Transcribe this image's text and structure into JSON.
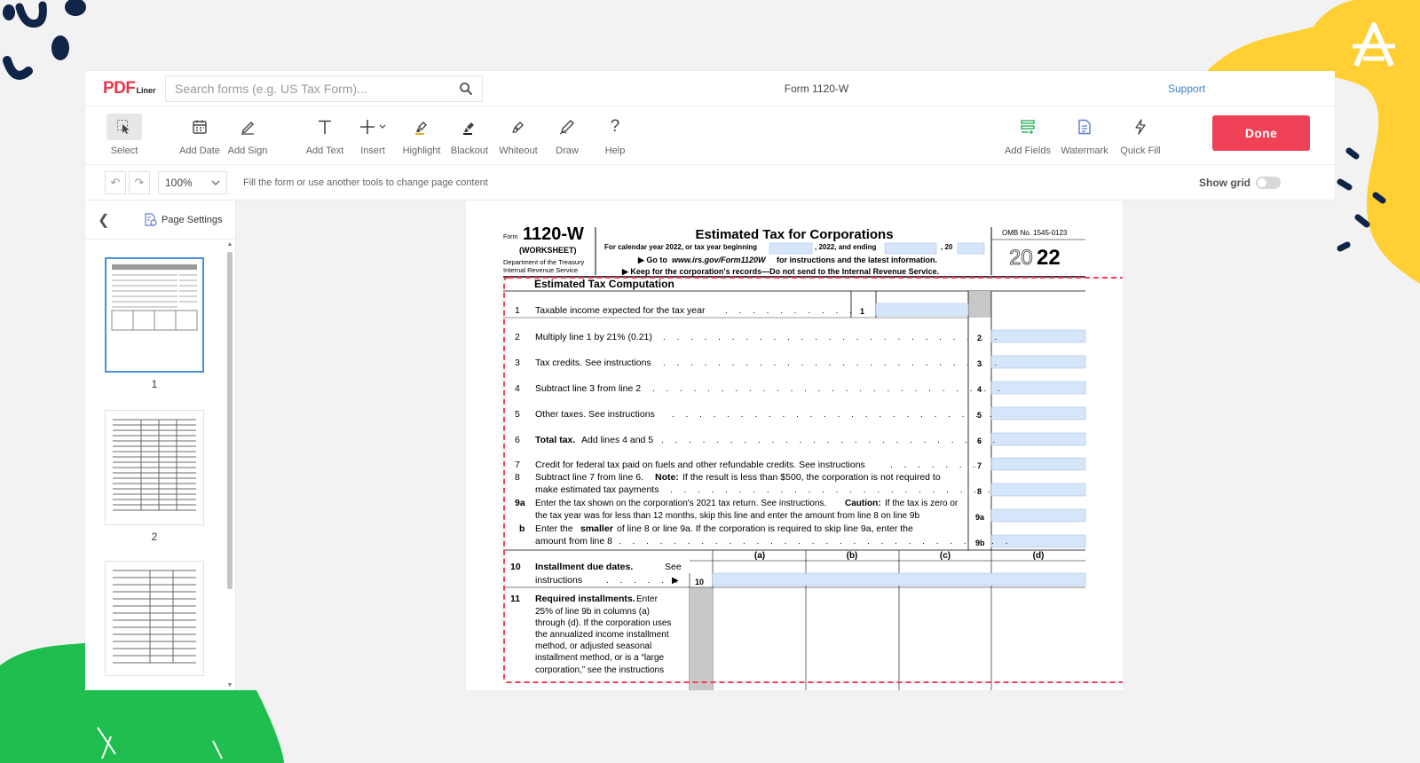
{
  "app": {
    "brand_pdf": "PDF",
    "brand_liner": "Liner",
    "doc_title": "Form 1120-W",
    "support_label": "Support"
  },
  "search": {
    "placeholder": "Search forms (e.g. US Tax Form)...",
    "icon": "search-icon"
  },
  "toolbar": {
    "tools": [
      {
        "label": "Select",
        "icon": "cursor-icon"
      },
      {
        "label": "Add Date",
        "icon": "calendar-icon"
      },
      {
        "label": "Add Sign",
        "icon": "signature-icon"
      },
      {
        "label": "Add Text",
        "icon": "text-icon"
      },
      {
        "label": "Insert",
        "icon": "plus-icon"
      },
      {
        "label": "Highlight",
        "icon": "highlighter-icon"
      },
      {
        "label": "Blackout",
        "icon": "blackout-icon"
      },
      {
        "label": "Whiteout",
        "icon": "whiteout-icon"
      },
      {
        "label": "Draw",
        "icon": "pen-icon"
      },
      {
        "label": "Help",
        "icon": "help-icon"
      },
      {
        "label": "Add Fields",
        "icon": "fields-icon"
      },
      {
        "label": "Watermark",
        "icon": "watermark-icon"
      },
      {
        "label": "Quick Fill",
        "icon": "bolt-icon"
      }
    ],
    "done_label": "Done",
    "accent": "#ef4257"
  },
  "subbar": {
    "zoom": "100%",
    "hint": "Fill the form or use another tools to change page content",
    "show_grid_label": "Show grid"
  },
  "sidebar": {
    "page_settings_label": "Page Settings",
    "thumbs": [
      {
        "num": "1"
      },
      {
        "num": "2"
      }
    ]
  },
  "form": {
    "form_word": "Form",
    "form_number": "1120-W",
    "worksheet": "(WORKSHEET)",
    "dept": "Department of the Treasury",
    "irs": "Internal Revenue Service",
    "title": "Estimated Tax for Corporations",
    "cal_year_prefix": "For calendar year 2022, or tax year beginning",
    "cal_year_mid": ", 2022, and ending",
    "cal_year_end": ", 20",
    "goto_prefix": "▶ Go to",
    "goto_url": "www.irs.gov/Form1120W",
    "goto_suffix": "for instructions and the latest information.",
    "keep": "▶ Keep for the corporation's records—Do not send to the Internal Revenue Service.",
    "omb": "OMB No. 1545-0123",
    "year_light": "20",
    "year_bold": "22",
    "section": "Estimated Tax Computation",
    "lines": [
      {
        "num": "1",
        "text": "Taxable income expected for the tax year",
        "box": "1"
      },
      {
        "num": "2",
        "text": "Multiply line 1 by 21% (0.21)",
        "box": "2"
      },
      {
        "num": "3",
        "text": "Tax credits. See instructions",
        "box": "3"
      },
      {
        "num": "4",
        "text": "Subtract line 3 from line 2",
        "box": "4"
      },
      {
        "num": "5",
        "text": "Other taxes. See instructions",
        "box": "5"
      },
      {
        "num": "6",
        "bold": "Total tax.",
        "text": "Add lines 4 and 5",
        "box": "6"
      },
      {
        "num": "7",
        "text": "Credit for federal tax paid on fuels and other refundable credits. See instructions",
        "box": "7"
      },
      {
        "num": "8",
        "text": "Subtract line 7 from line 6.",
        "bold2": "Note:",
        "text2": "If the result is less than $500, the corporation is not required to",
        "text3": "make estimated tax payments",
        "box": "8"
      },
      {
        "num": "9a",
        "text": "Enter the tax shown on the corporation's 2021 tax return. See instructions.",
        "bold2": "Caution:",
        "text2": "If the tax is zero or",
        "text3": "the tax year was for less than 12 months, skip this line and enter the amount from line 8 on line 9b",
        "box": "9a"
      },
      {
        "num": "b",
        "text": "Enter the",
        "bold2": "smaller",
        "text2": "of line 8 or line 9a. If the corporation is required to skip line 9a, enter the",
        "text3": "amount from line 8",
        "box": "9b"
      }
    ],
    "cols": [
      "(a)",
      "(b)",
      "(c)",
      "(d)"
    ],
    "line10_num": "10",
    "line10_bold": "Installment due dates.",
    "line10_text": "See",
    "line10_text2": "instructions",
    "line10_box": "10",
    "line11_num": "11",
    "line11_bold": "Required installments.",
    "line11_rest": [
      "Enter",
      "25% of line 9b in columns (a)",
      "through (d). If the corporation uses",
      "the annualized income installment",
      "method, or adjusted seasonal",
      "installment method, or is a “large",
      "corporation,” see the  instructions"
    ]
  },
  "annotation": {
    "label": "1"
  }
}
